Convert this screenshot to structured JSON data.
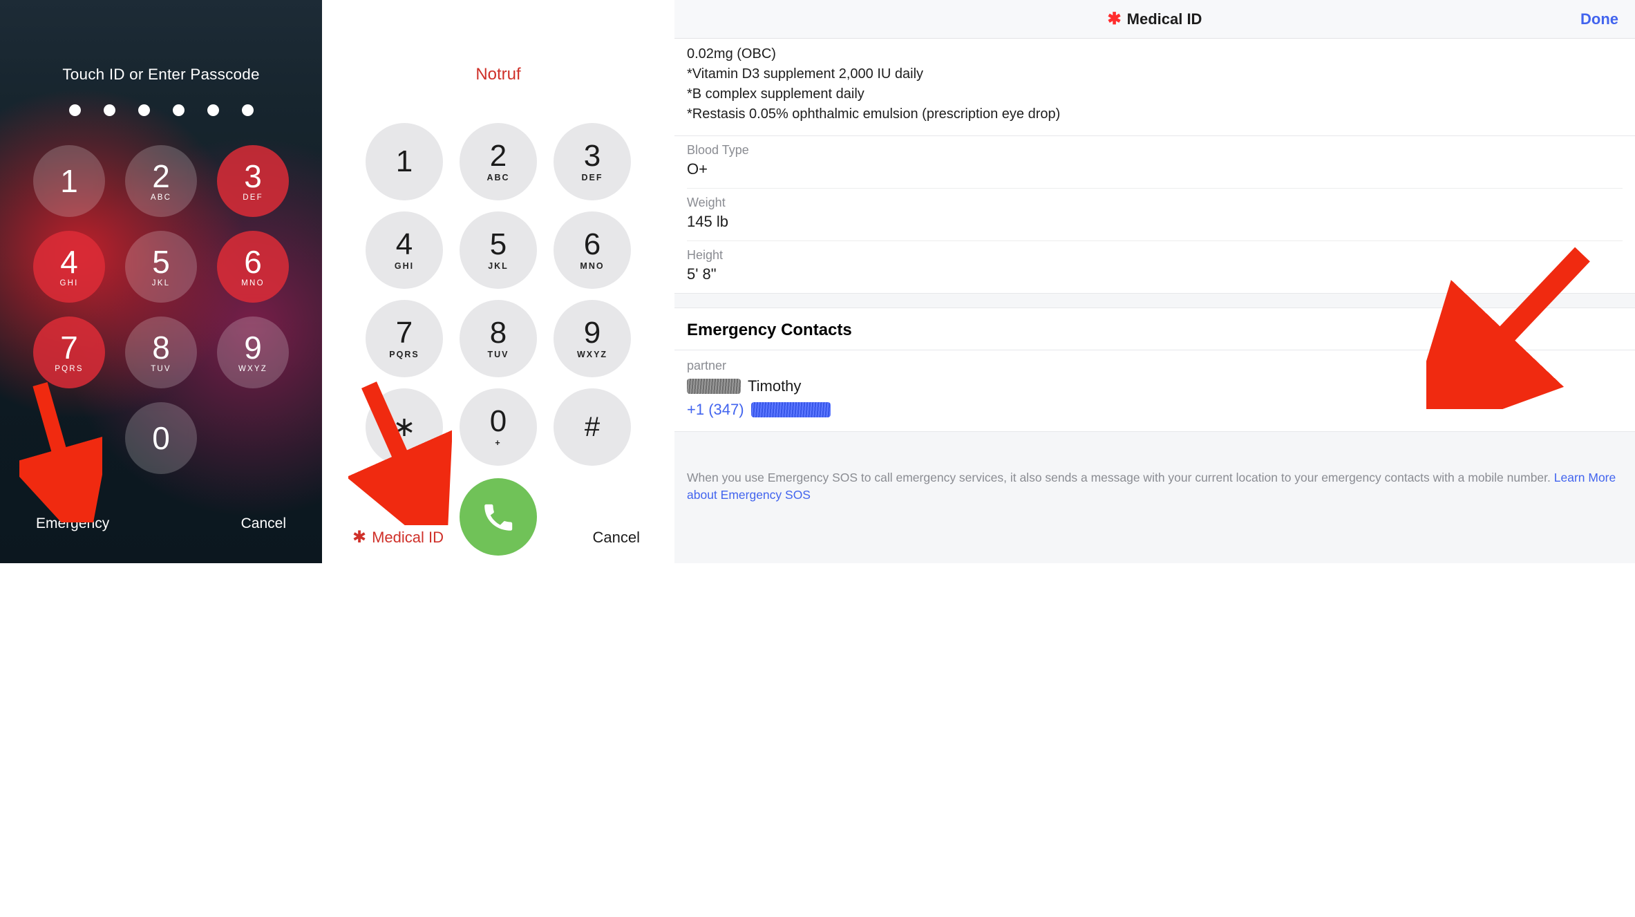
{
  "lock": {
    "prompt": "Touch ID or Enter Passcode",
    "dots": 6,
    "keys": [
      {
        "num": "1",
        "sub": "",
        "red": false
      },
      {
        "num": "2",
        "sub": "ABC",
        "red": false
      },
      {
        "num": "3",
        "sub": "DEF",
        "red": true
      },
      {
        "num": "4",
        "sub": "GHI",
        "red": true
      },
      {
        "num": "5",
        "sub": "JKL",
        "red": false
      },
      {
        "num": "6",
        "sub": "MNO",
        "red": true
      },
      {
        "num": "7",
        "sub": "PQRS",
        "red": true
      },
      {
        "num": "8",
        "sub": "TUV",
        "red": false
      },
      {
        "num": "9",
        "sub": "WXYZ",
        "red": false
      },
      {
        "num": "",
        "sub": "",
        "red": false,
        "blank": true
      },
      {
        "num": "0",
        "sub": "",
        "red": false
      },
      {
        "num": "",
        "sub": "",
        "red": false,
        "blank": true
      }
    ],
    "emergency_label": "Emergency",
    "cancel_label": "Cancel"
  },
  "dialer": {
    "title": "Notruf",
    "keys": [
      {
        "num": "1",
        "sub": ""
      },
      {
        "num": "2",
        "sub": "ABC"
      },
      {
        "num": "3",
        "sub": "DEF"
      },
      {
        "num": "4",
        "sub": "GHI"
      },
      {
        "num": "5",
        "sub": "JKL"
      },
      {
        "num": "6",
        "sub": "MNO"
      },
      {
        "num": "7",
        "sub": "PQRS"
      },
      {
        "num": "8",
        "sub": "TUV"
      },
      {
        "num": "9",
        "sub": "WXYZ"
      },
      {
        "num": "∗",
        "sub": "",
        "sym": true
      },
      {
        "num": "0",
        "sub": "+"
      },
      {
        "num": "#",
        "sub": "",
        "sym": true
      }
    ],
    "medical_id_label": "Medical ID",
    "cancel_label": "Cancel"
  },
  "medical": {
    "header_title": "Medical ID",
    "done_label": "Done",
    "medications": [
      "0.02mg (OBC)",
      "*Vitamin D3 supplement 2,000 IU daily",
      "*B complex supplement daily",
      "*Restasis 0.05% ophthalmic emulsion (prescription eye drop)"
    ],
    "fields": [
      {
        "label": "Blood Type",
        "value": "O+"
      },
      {
        "label": "Weight",
        "value": "145 lb"
      },
      {
        "label": "Height",
        "value": "5' 8\""
      }
    ],
    "emergency_section_title": "Emergency Contacts",
    "contact": {
      "relationship": "partner",
      "name_visible": "Timothy",
      "phone_visible": "+1 (347)"
    },
    "footer_text": "When you use Emergency SOS to call emergency services, it also sends a message with your current location to your emergency contacts with a mobile number. ",
    "footer_link": "Learn More about Emergency SOS"
  },
  "annotations": {
    "arrow_color": "#f02a10"
  }
}
